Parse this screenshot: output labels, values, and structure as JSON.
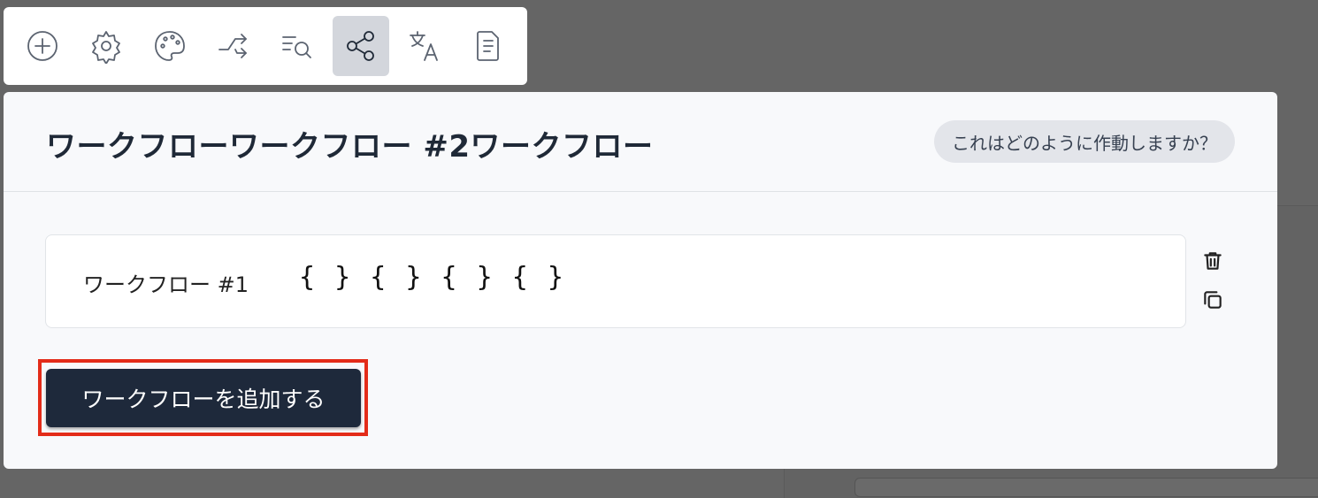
{
  "toolbar": {
    "icons": [
      "plus-circle-icon",
      "settings-icon",
      "palette-icon",
      "shuffle-icon",
      "search-list-icon",
      "share-icon",
      "translate-icon",
      "document-icon"
    ],
    "active_index": 5
  },
  "modal": {
    "title": "ワークフローワークフロー #2ワークフロー",
    "help_label": "これはどのように作動しますか？"
  },
  "workflows": [
    {
      "label": "ワークフロー #1",
      "expression": "{ } { } { } { }"
    }
  ],
  "add_button_label": "ワークフローを追加する"
}
